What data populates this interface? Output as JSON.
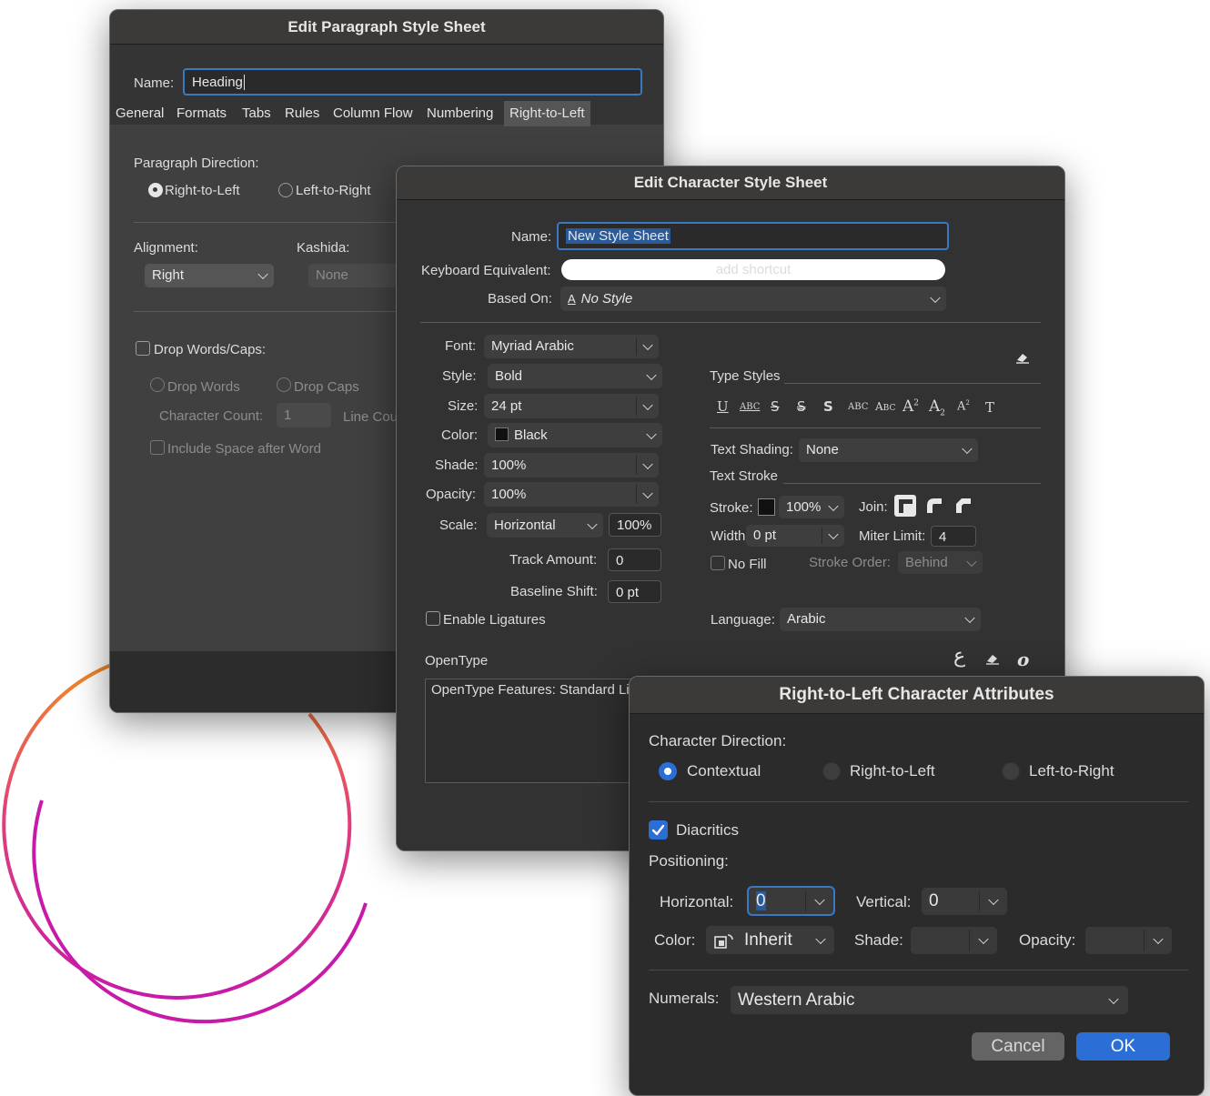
{
  "paragraph_dialog": {
    "title": "Edit Paragraph Style Sheet",
    "name_label": "Name:",
    "name_value": "Heading",
    "tabs": [
      "General",
      "Formats",
      "Tabs",
      "Rules",
      "Column Flow",
      "Numbering",
      "Right-to-Left"
    ],
    "active_tab": "Right-to-Left",
    "direction_label": "Paragraph Direction:",
    "dir_rtl": "Right-to-Left",
    "dir_ltr": "Left-to-Right",
    "alignment_label": "Alignment:",
    "alignment_value": "Right",
    "kashida_label": "Kashida:",
    "kashida_value": "None",
    "drop_words_caps": "Drop Words/Caps:",
    "drop_words": "Drop Words",
    "drop_caps": "Drop Caps",
    "char_count_label": "Character Count:",
    "char_count_value": "1",
    "line_count_label": "Line Cou",
    "include_space": "Include Space after Word"
  },
  "character_dialog": {
    "title": "Edit Character Style Sheet",
    "name_label": "Name:",
    "name_value": "New Style Sheet",
    "keyboard_label": "Keyboard Equivalent:",
    "keyboard_placeholder": "add shortcut",
    "based_on_label": "Based On:",
    "based_on_value": "No Style",
    "font_label": "Font:",
    "font_value": "Myriad Arabic",
    "style_label": "Style:",
    "style_value": "Bold",
    "size_label": "Size:",
    "size_value": "24 pt",
    "color_label": "Color:",
    "color_value": "Black",
    "shade_label": "Shade:",
    "shade_value": "100%",
    "opacity_label": "Opacity:",
    "opacity_value": "100%",
    "scale_label": "Scale:",
    "scale_value": "Horizontal",
    "scale_pct": "100%",
    "track_label": "Track Amount:",
    "track_value": "0",
    "baseline_label": "Baseline Shift:",
    "baseline_value": "0 pt",
    "ligatures": "Enable Ligatures",
    "type_styles": "Type Styles",
    "text_shading_label": "Text Shading:",
    "text_shading_value": "None",
    "text_stroke": "Text Stroke",
    "stroke_label": "Stroke:",
    "stroke_pct": "100%",
    "join_label": "Join:",
    "width_label": "Width:",
    "width_value": "0 pt",
    "miter_label": "Miter Limit:",
    "miter_value": "4",
    "no_fill": "No Fill",
    "stroke_order_label": "Stroke Order:",
    "stroke_order_value": "Behind",
    "language_label": "Language:",
    "language_value": "Arabic",
    "opentype": "OpenType",
    "opentype_features": "OpenType Features: Standard Li"
  },
  "rtl_dialog": {
    "title": "Right-to-Left Character Attributes",
    "direction_label": "Character Direction:",
    "contextual": "Contextual",
    "rtl": "Right-to-Left",
    "ltr": "Left-to-Right",
    "diacritics": "Diacritics",
    "positioning": "Positioning:",
    "horizontal_label": "Horizontal:",
    "horizontal_value": "0",
    "vertical_label": "Vertical:",
    "vertical_value": "0",
    "color_label": "Color:",
    "color_value": "Inherit",
    "shade_label": "Shade:",
    "opacity_label": "Opacity:",
    "numerals_label": "Numerals:",
    "numerals_value": "Western Arabic",
    "cancel": "Cancel",
    "ok": "OK"
  },
  "colors": {
    "accent": "#2b6fd6",
    "focus_ring": "#3a78c2",
    "dialog_bg": "#323232",
    "deco_arc_start": "#f08a24",
    "deco_arc_end": "#c81aa8"
  }
}
